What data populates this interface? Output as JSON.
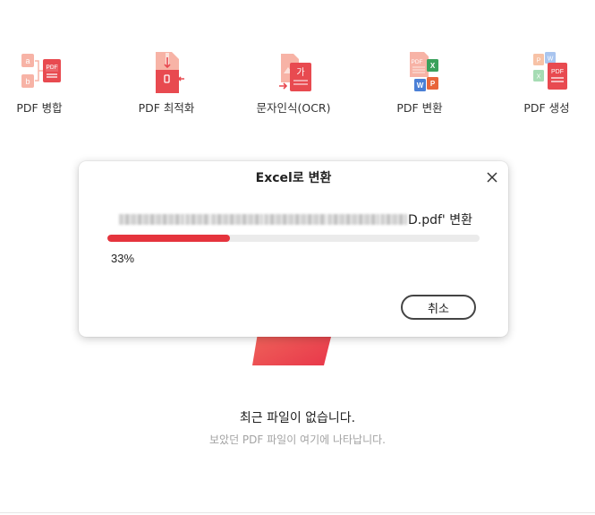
{
  "tools": [
    {
      "label": "PDF 병합",
      "icon": "merge-pdf-icon"
    },
    {
      "label": "PDF 최적화",
      "icon": "compress-pdf-icon"
    },
    {
      "label": "문자인식(OCR)",
      "icon": "ocr-icon"
    },
    {
      "label": "PDF 변환",
      "icon": "convert-pdf-icon"
    },
    {
      "label": "PDF 생성",
      "icon": "create-pdf-icon"
    }
  ],
  "dialog": {
    "title": "Excel로 변환",
    "file_suffix": "D.pdf' 변환",
    "progress_text": "33%",
    "progress_fraction": 0.33,
    "cancel_label": "취소"
  },
  "empty_state": {
    "title": "최근 파일이 없습니다.",
    "subtitle": "보았던 PDF 파일이 여기에 나타납니다."
  },
  "colors": {
    "accent": "#e5343d",
    "icon_light": "#f4a89a",
    "icon_dark": "#e84a50"
  }
}
